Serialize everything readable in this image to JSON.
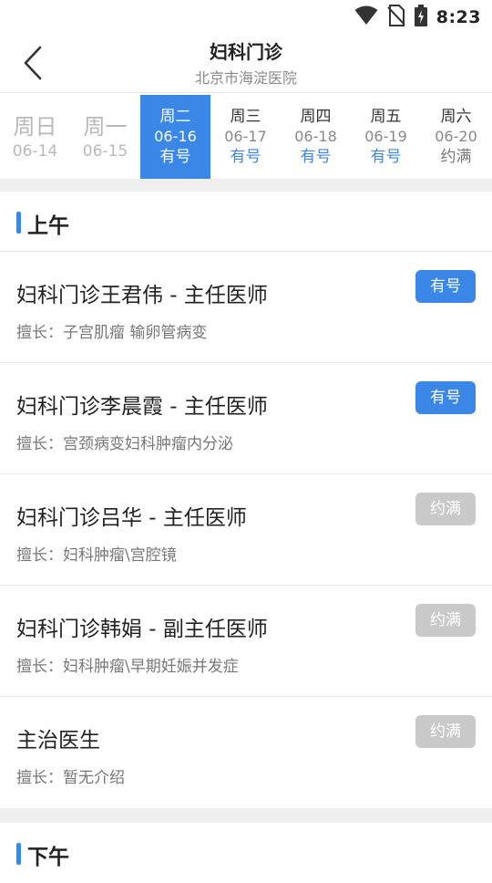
{
  "status_bar": {
    "time": "8:23"
  },
  "header": {
    "title": "妇科门诊",
    "subtitle": "北京市海淀医院"
  },
  "dates": [
    {
      "weekday": "周日",
      "date": "06-14",
      "availability": ""
    },
    {
      "weekday": "周一",
      "date": "06-15",
      "availability": ""
    },
    {
      "weekday": "周二",
      "date": "06-16",
      "availability": "有号"
    },
    {
      "weekday": "周三",
      "date": "06-17",
      "availability": "有号"
    },
    {
      "weekday": "周四",
      "date": "06-18",
      "availability": "有号"
    },
    {
      "weekday": "周五",
      "date": "06-19",
      "availability": "有号"
    },
    {
      "weekday": "周六",
      "date": "06-20",
      "availability": "约满"
    }
  ],
  "morning": {
    "label": "上午",
    "doctors": [
      {
        "name": "妇科门诊王君伟 - 主任医师",
        "specialty": "擅长：子宫肌瘤 输卵管病变",
        "status": "有号"
      },
      {
        "name": "妇科门诊李晨霞 - 主任医师",
        "specialty": "擅长：宫颈病变妇科肿瘤内分泌",
        "status": "有号"
      },
      {
        "name": "妇科门诊吕华 - 主任医师",
        "specialty": "擅长：妇科肿瘤\\宫腔镜",
        "status": "约满"
      },
      {
        "name": "妇科门诊韩娟 - 副主任医师",
        "specialty": "擅长：妇科肿瘤\\早期妊娠并发症",
        "status": "约满"
      },
      {
        "name": "主治医生",
        "specialty": "擅长：暂无介绍",
        "status": "约满"
      }
    ]
  },
  "afternoon": {
    "label": "下午"
  },
  "colors": {
    "accent": "#3a87e8",
    "full_badge": "#c9c9c9",
    "divider": "#efefef"
  }
}
